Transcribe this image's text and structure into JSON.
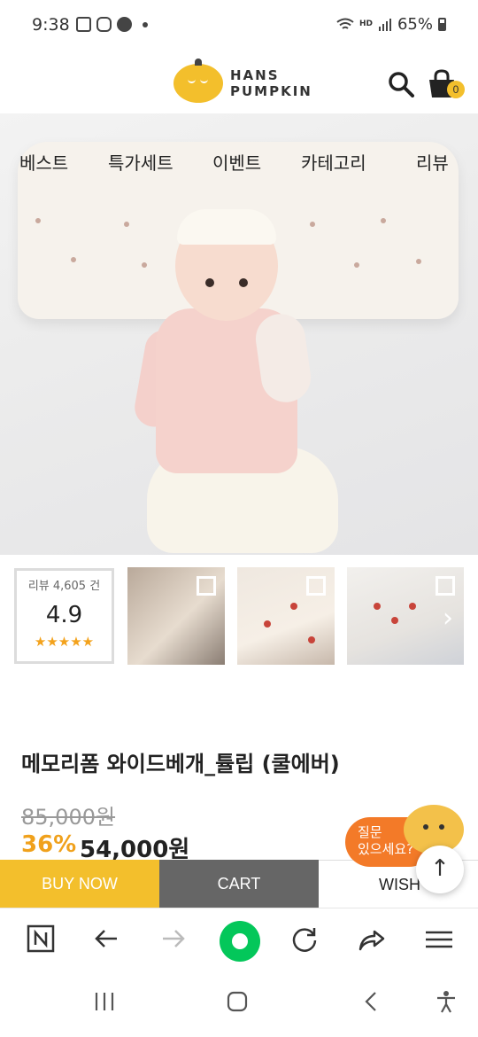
{
  "status_bar": {
    "time": "9:38",
    "battery": "65%",
    "hd_label": "HD"
  },
  "header": {
    "logo_line1": "HANS",
    "logo_line2": "PUMPKIN",
    "cart_count": "0",
    "brand_color": "#f3bf2c"
  },
  "categories": [
    "베스트",
    "특가세트",
    "이벤트",
    "카테고리",
    "리뷰"
  ],
  "review": {
    "count_label": "리뷰 4,605 건",
    "score": "4.9",
    "stars": "★★★★★"
  },
  "product": {
    "title": "메모리폼 와이드베개_튤립 (쿨에버)",
    "original_price": "85,000원",
    "discount": "36%",
    "sale_price": "54,000원"
  },
  "chat": {
    "line1": "질문",
    "line2": "있으세요?"
  },
  "actions": {
    "buy_now": "BUY NOW",
    "cart": "CART",
    "wish": "WISH"
  },
  "icons": {
    "search": "search-icon",
    "cart": "shopping-bag-icon",
    "scroll_top": "arrow-up-icon"
  }
}
